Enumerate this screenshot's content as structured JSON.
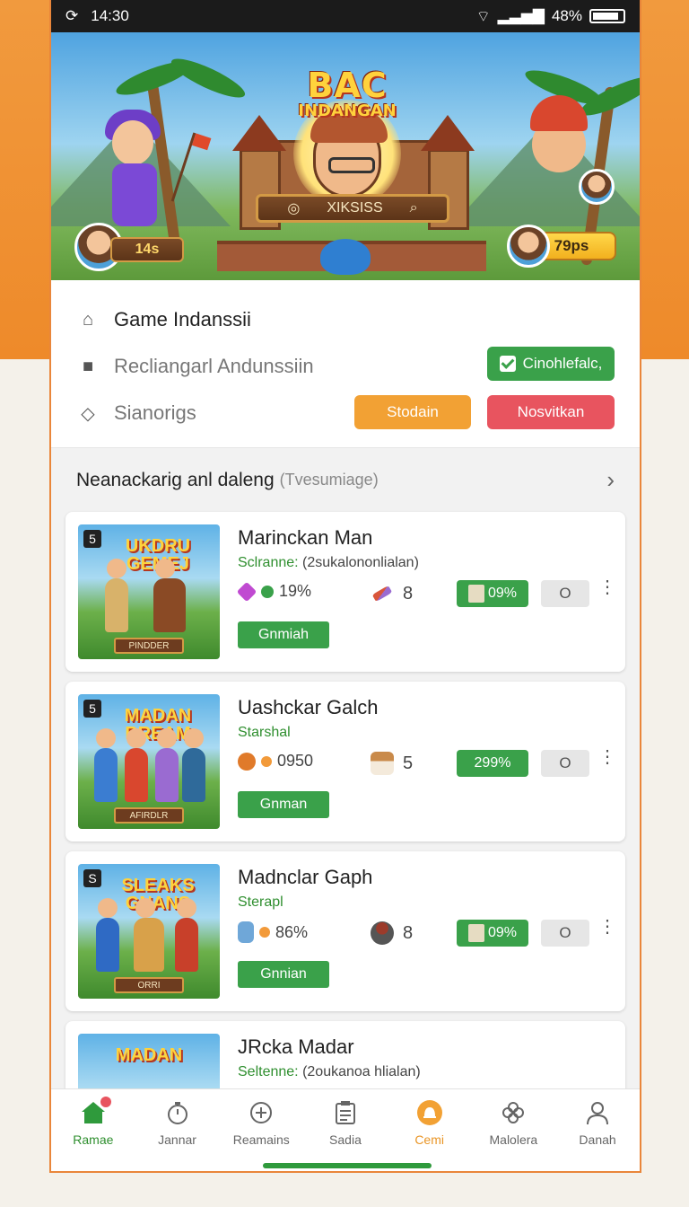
{
  "status_bar": {
    "time": "14:30",
    "battery": "48%"
  },
  "banner": {
    "title_line1": "BAC",
    "title_line2": "INDANGAN",
    "plaque_text": "XIKSISS",
    "plaque_left_icon": "coin-icon",
    "plaque_right_icon": "search-icon",
    "left_score": "14s",
    "right_score": "79ps"
  },
  "menu": {
    "items": [
      {
        "icon": "home-icon",
        "label": "Game Indanssii"
      },
      {
        "icon": "cube-icon",
        "label": "Recliangarl Andunssiin"
      },
      {
        "icon": "shield-icon",
        "label": "Sianorigs"
      }
    ],
    "confirm_button": "Cinohlefalc,",
    "primary_button": "Stodain",
    "secondary_button": "Nosvitkan"
  },
  "section": {
    "title": "Neanackarig anl daleng",
    "subtitle": "(Tvesumiage)"
  },
  "games": [
    {
      "name": "Marinckan Man",
      "subtitle_label": "Sclranne:",
      "subtitle_value": "(2sukalononlialan)",
      "thumb_title": "UKDRU GEMEJ",
      "thumb_footer": "PINDDER",
      "thumb_badge": "5",
      "stat_a": "19%",
      "stat_b": "8",
      "percent": "09%",
      "toggle": "O",
      "play_label": "Gnmiah",
      "gem_color": "#c04ad1",
      "tool_color": "#d9563b"
    },
    {
      "name": "Uashckar Galch",
      "subtitle_label": "Starshal",
      "subtitle_value": "",
      "thumb_title": "MADAN BREAM",
      "thumb_footer": "AFIRDLR",
      "thumb_badge": "5",
      "stat_a": "0950",
      "stat_b": "5",
      "percent": "299%",
      "toggle": "O",
      "play_label": "Gnman",
      "gem_color": "#e07a2a",
      "tool_color": "#d7a06b"
    },
    {
      "name": "Madnclar Gaph",
      "subtitle_label": "Sterapl",
      "subtitle_value": "",
      "thumb_title": "SLEAKS GNANS",
      "thumb_footer": "ORRI",
      "thumb_badge": "S",
      "stat_a": "86%",
      "stat_b": "8",
      "percent": "09%",
      "toggle": "O",
      "play_label": "Gnnian",
      "gem_color": "#6fa7d8",
      "tool_color": "#9c3b2b"
    },
    {
      "name": "JRcka Madar",
      "subtitle_label": "Seltenne:",
      "subtitle_value": "(2oukanoa hlialan)",
      "thumb_title": "MADAN",
      "thumb_footer": "",
      "thumb_badge": "",
      "stat_a": "",
      "stat_b": "",
      "percent": "",
      "toggle": "",
      "play_label": "",
      "gem_color": "#3aa14a",
      "tool_color": "#d9563b"
    }
  ],
  "bottom_nav": [
    {
      "icon": "home-icon",
      "label": "Ramae"
    },
    {
      "icon": "stopwatch-icon",
      "label": "Jannar"
    },
    {
      "icon": "plus-circle-icon",
      "label": "Reamains"
    },
    {
      "icon": "clipboard-icon",
      "label": "Sadia"
    },
    {
      "icon": "bell-icon",
      "label": "Cemi"
    },
    {
      "icon": "flower-icon",
      "label": "Malolera"
    },
    {
      "icon": "user-icon",
      "label": "Danah"
    }
  ]
}
